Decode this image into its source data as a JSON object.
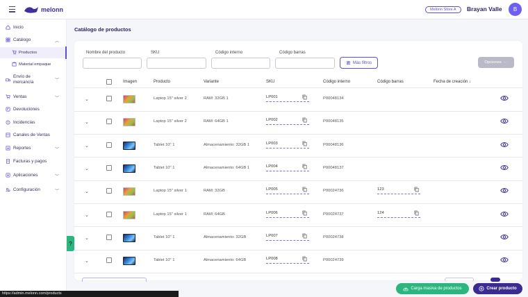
{
  "header": {
    "logo_text": "melonn",
    "store": "Melonn Store A",
    "user_name": "Brayan Valle",
    "avatar_letter": "B"
  },
  "sidebar": {
    "items": [
      {
        "label": "Inicio",
        "icon": "home-icon"
      },
      {
        "label": "Catálogo",
        "icon": "catalog-icon"
      },
      {
        "label": "Envío de",
        "label2": "mercancía",
        "icon": "truck-icon"
      },
      {
        "label": "Ventas",
        "icon": "cart-icon"
      },
      {
        "label": "Devoluciones",
        "icon": "return-icon"
      },
      {
        "label": "Incidencias",
        "icon": "warning-icon"
      },
      {
        "label": "Canales de Ventas",
        "icon": "channels-icon"
      },
      {
        "label": "Reportes",
        "icon": "chart-icon"
      },
      {
        "label": "Facturas y pagos",
        "icon": "invoice-icon"
      },
      {
        "label": "Aplicaciones",
        "icon": "apps-icon"
      },
      {
        "label": "Configuración",
        "icon": "gear-icon"
      }
    ],
    "sub_items": [
      {
        "label": "Productos"
      },
      {
        "label": "Material empaque"
      }
    ]
  },
  "page": {
    "title": "Catálogo de productos"
  },
  "filters": {
    "nombre_label": "Nombre del producto",
    "sku_label": "SKU",
    "codigo_interno_label": "Código interno",
    "codigo_barras_label": "Código barras",
    "more_filters": "Más filtros",
    "options": "Opciones"
  },
  "table": {
    "headers": {
      "imagen": "Imagen",
      "producto": "Producto",
      "variante": "Variante",
      "sku": "SKU",
      "codigo_interno": "Código interno",
      "codigo_barras": "Código barras",
      "fecha": "Fecha de creación"
    },
    "rows": [
      {
        "thumb": "laptop",
        "producto": "Laptop 15\" silver 2",
        "variante": "RAM: 32GB 1",
        "sku": "LP001",
        "interno": "P00048134",
        "barras": ""
      },
      {
        "thumb": "laptop",
        "producto": "Laptop 15\" silver 2",
        "variante": "RAM: 64GB 1",
        "sku": "LP002",
        "interno": "P00048135",
        "barras": ""
      },
      {
        "thumb": "tablet",
        "producto": "Tablet 10\" 1",
        "variante": "Almacenamiento: 32GB 1",
        "sku": "LP003",
        "interno": "P00048136",
        "barras": ""
      },
      {
        "thumb": "tablet",
        "producto": "Tablet 10\" 1",
        "variante": "Almacenamiento: 64GB 1",
        "sku": "LP004",
        "interno": "P00048137",
        "barras": ""
      },
      {
        "thumb": "laptop",
        "producto": "Laptop 15\" silver 1",
        "variante": "RAM: 32GB",
        "sku": "LP005",
        "interno": "P00024736",
        "barras": "123"
      },
      {
        "thumb": "laptop",
        "producto": "Laptop 15\" silver 1",
        "variante": "RAM: 64GB",
        "sku": "LP006",
        "interno": "P00024737",
        "barras": "124"
      },
      {
        "thumb": "tablet",
        "producto": "Tablet 10\" 1",
        "variante": "Almacenamiento: 32GB",
        "sku": "LP007",
        "interno": "P00024738",
        "barras": ""
      },
      {
        "thumb": "tablet",
        "producto": "Tablet 10\" 1",
        "variante": "Almacenamiento: 64GB",
        "sku": "LP008",
        "interno": "P00024739",
        "barras": ""
      }
    ]
  },
  "actions": {
    "bulk_upload": "Carga masiva de productos",
    "create": "Crear producto"
  },
  "status_url": "https://admin.melonn.com/products",
  "colors": {
    "brand": "#3b2a8f",
    "accent": "#5b4fd0",
    "green": "#2bb57f"
  }
}
